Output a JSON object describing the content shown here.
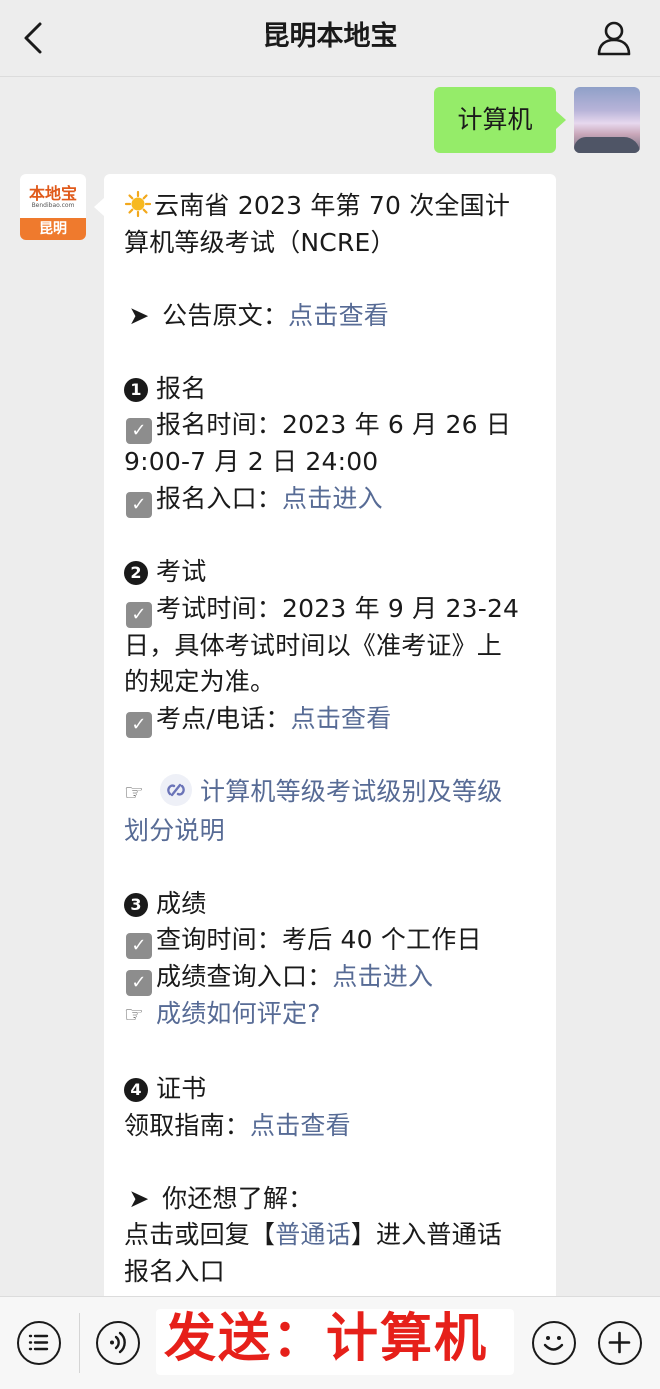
{
  "header": {
    "title": "昆明本地宝"
  },
  "chat": {
    "user_message": "计算机",
    "bot_logo": {
      "top": "本地宝",
      "url": "Bendibao.com",
      "bar": "昆明"
    },
    "reply": {
      "title_line1": "云南省 2023 年第 70 次全国计",
      "title_line2": "算机等级考试（NCRE）",
      "notice_prefix": "公告原文：",
      "notice_link": "点击查看",
      "sec1_num": "1",
      "sec1_title": "报名",
      "reg_time_line1": "报名时间：2023 年 6 月 26 日",
      "reg_time_line2": "9:00-7 月 2 日 24:00",
      "reg_entry_prefix": "报名入口：",
      "reg_entry_link": "点击进入",
      "sec2_num": "2",
      "sec2_title": "考试",
      "exam_time_line1": "考试时间：2023 年 9 月 23-24",
      "exam_time_line2": "日，具体考试时间以《准考证》上",
      "exam_time_line3": "的规定为准。",
      "exam_site_prefix": "考点/电话：",
      "exam_site_link": "点击查看",
      "mini_link_line1": "计算机等级考试级别及等级",
      "mini_link_line2": "划分说明",
      "sec3_num": "3",
      "sec3_title": "成绩",
      "score_time": "查询时间：考后 40 个工作日",
      "score_entry_prefix": "成绩查询入口：",
      "score_entry_link": "点击进入",
      "score_rule_link": "成绩如何评定?",
      "sec4_num": "4",
      "sec4_title": "证书",
      "cert_prefix": "领取指南：",
      "cert_link": "点击查看",
      "more_title": "你还想了解：",
      "more_line1_prefix": "点击或回复【",
      "more_line1_link": "普通话",
      "more_line1_suffix": "】进入普通话",
      "more_line2": "报名入口"
    }
  },
  "bottombar": {
    "overlay_text": "发送：计算机"
  },
  "icons": {
    "back": "back-arrow-icon",
    "user": "user-profile-icon",
    "sun": "sun-emoji-icon",
    "arrow": "arrow-pointer-icon",
    "check": "checkbox-icon",
    "hand": "pointing-hand-icon",
    "mini": "mini-program-icon",
    "menu": "menu-icon",
    "voice": "voice-icon",
    "emoji": "emoji-icon",
    "plus": "plus-icon"
  }
}
